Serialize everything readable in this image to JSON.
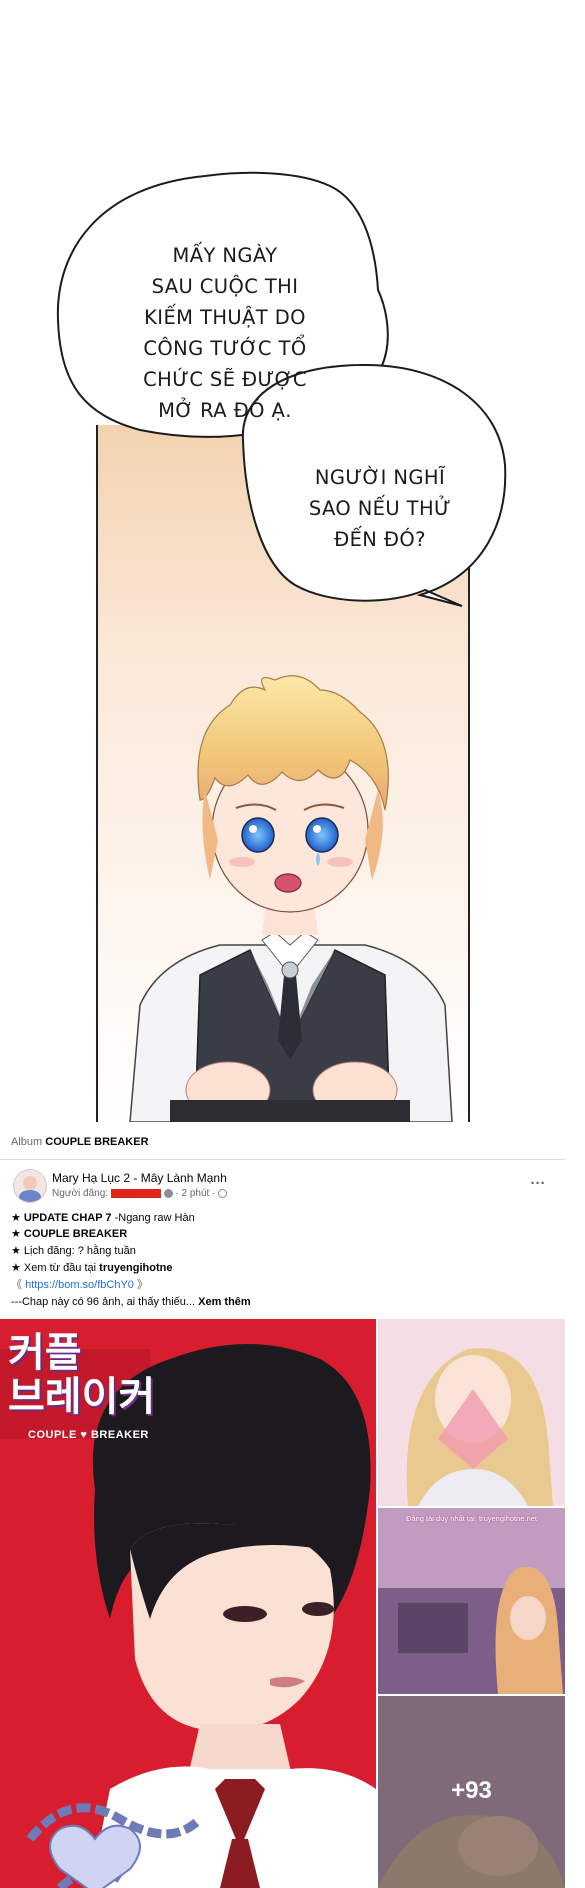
{
  "speech_bubbles": [
    {
      "lines": [
        "MẤY NGÀY",
        "SAU CUỘC THI",
        "KIẾM THUẬT DO",
        "CÔNG TƯỚC TỔ",
        "CHỨC SẼ ĐƯỢC",
        "MỞ RA ĐÓ Ạ."
      ]
    },
    {
      "lines": [
        "NGƯỜI NGHĨ",
        "SAO NẾU THỬ",
        "ĐẾN ĐÓ?"
      ]
    }
  ],
  "album": {
    "prefix": "Album",
    "name": "COUPLE BREAKER"
  },
  "post": {
    "author": "Mary Hạ Lục 2 - Mây Lành Mạnh",
    "poster_prefix": "Người đăng:",
    "time": "· 2 phút ·",
    "more_label": "···",
    "lines": {
      "l1_bold": "★ UPDATE CHAP 7",
      "l1_rest": " -Ngang raw Hàn",
      "l2_bold": "★ COUPLE BREAKER",
      "l3": "★ Lịch đăng: ? hằng tuần",
      "l4_text": "★ Xem từ đầu tại ",
      "l4_bold": "truyengihotne",
      "l5_open": "《 ",
      "l5_link": "https://bom.so/fbChY0",
      "l5_close": " 》",
      "l6_text": "---Chap này có 96 ảnh, ai thấy thiếu... ",
      "l6_more": "Xem thêm"
    }
  },
  "photos": {
    "cover_title_line1": "커플",
    "cover_title_line2": "브레이커",
    "cover_subtitle": "COUPLE ♥ BREAKER",
    "watermark": "Đăng tải duy nhất tại: truyengihotne.net",
    "more_count": "+93"
  }
}
